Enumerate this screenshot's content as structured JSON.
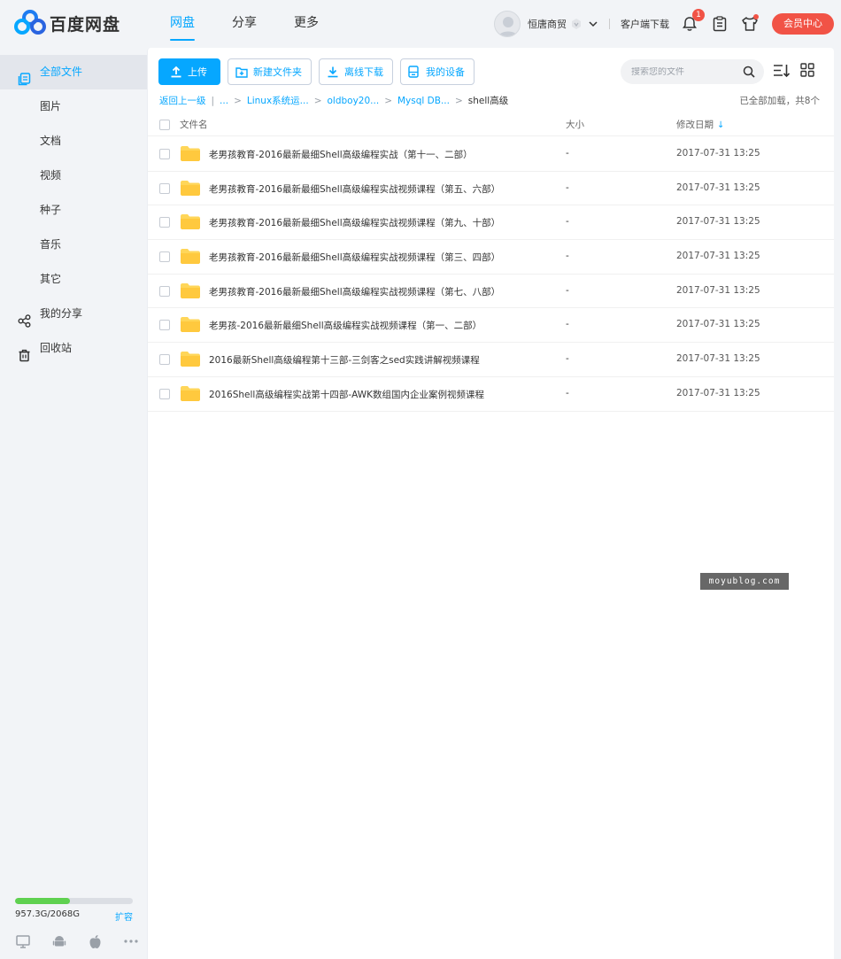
{
  "brand": {
    "name": "百度网盘",
    "color": "#06a7ff"
  },
  "nav": [
    {
      "label": "网盘",
      "active": true
    },
    {
      "label": "分享",
      "active": false
    },
    {
      "label": "更多",
      "active": false
    }
  ],
  "user": {
    "name": "恒唐商贸",
    "client_download": "客户端下载",
    "notification_count": "1",
    "vip_button": "会员中心"
  },
  "sidebar": {
    "items": [
      {
        "label": "全部文件",
        "icon": "all-files-icon",
        "active": true
      },
      {
        "label": "图片"
      },
      {
        "label": "文档"
      },
      {
        "label": "视频"
      },
      {
        "label": "种子"
      },
      {
        "label": "音乐"
      },
      {
        "label": "其它"
      },
      {
        "label": "我的分享",
        "icon": "share-icon"
      },
      {
        "label": "回收站",
        "icon": "trash-icon"
      }
    ],
    "storage": {
      "used_text": "957.3G/2068G",
      "expand_label": "扩容",
      "used_fraction": 0.463
    }
  },
  "toolbar": {
    "upload": "上传",
    "new_folder": "新建文件夹",
    "offline_download": "离线下载",
    "my_devices": "我的设备"
  },
  "search": {
    "placeholder": "搜索您的文件"
  },
  "breadcrumb": {
    "back": "返回上一级",
    "ellipsis": "...",
    "items": [
      "Linux系统运...",
      "oldboy20...",
      "Mysql DB..."
    ],
    "current": "shell高级",
    "status": "已全部加载，共8个"
  },
  "table": {
    "headers": {
      "name": "文件名",
      "size": "大小",
      "modified": "修改日期"
    },
    "rows": [
      {
        "name": "老男孩教育-2016最新最细Shell高级编程实战（第十一、二部）",
        "size": "-",
        "modified": "2017-07-31 13:25"
      },
      {
        "name": "老男孩教育-2016最新最细Shell高级编程实战视频课程（第五、六部）",
        "size": "-",
        "modified": "2017-07-31 13:25"
      },
      {
        "name": "老男孩教育-2016最新最细Shell高级编程实战视频课程（第九、十部）",
        "size": "-",
        "modified": "2017-07-31 13:25"
      },
      {
        "name": "老男孩教育-2016最新最细Shell高级编程实战视频课程（第三、四部）",
        "size": "-",
        "modified": "2017-07-31 13:25"
      },
      {
        "name": "老男孩教育-2016最新最细Shell高级编程实战视频课程（第七、八部）",
        "size": "-",
        "modified": "2017-07-31 13:25"
      },
      {
        "name": "老男孩-2016最新最细Shell高级编程实战视频课程（第一、二部）",
        "size": "-",
        "modified": "2017-07-31 13:25"
      },
      {
        "name": "2016最新Shell高级编程第十三部-三剑客之sed实践讲解视频课程",
        "size": "-",
        "modified": "2017-07-31 13:25"
      },
      {
        "name": "2016Shell高级编程实战第十四部-AWK数组国内企业案例视频课程",
        "size": "-",
        "modified": "2017-07-31 13:25"
      }
    ]
  },
  "watermark": "moyublog.com"
}
